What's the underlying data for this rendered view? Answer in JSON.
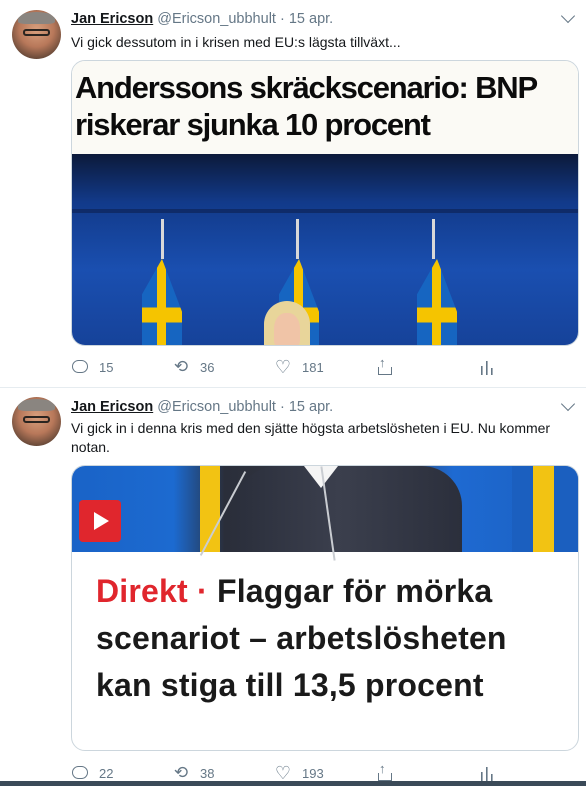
{
  "tweets": [
    {
      "author_name": "Jan Ericson",
      "handle": "@Ericson_ubbhult",
      "separator": "·",
      "date": "15 apr.",
      "text": "Vi gick dessutom in i krisen med EU:s lägsta tillväxt...",
      "card": {
        "headline_line1": "Anderssons skräckscenario: BNP",
        "headline_line2": "riskerar sjunka 10 procent"
      },
      "counts": {
        "replies": "15",
        "retweets": "36",
        "likes": "181"
      }
    },
    {
      "author_name": "Jan Ericson",
      "handle": "@Ericson_ubbhult",
      "separator": "·",
      "date": "15 apr.",
      "text": "Vi gick in i denna kris med den sjätte högsta arbetslösheten i EU. Nu kommer notan.",
      "card": {
        "kicker": "Direkt",
        "kicker_separator": " · ",
        "headline": "Flaggar för mörka scenariot – arbetslösheten kan stiga till 13,5 procent"
      },
      "counts": {
        "replies": "22",
        "retweets": "38",
        "likes": "193"
      }
    }
  ],
  "icons": {
    "reply": "reply-icon",
    "retweet": "retweet-icon",
    "like": "heart-icon",
    "share": "share-icon",
    "analytics": "analytics-icon",
    "more": "chevron-down-icon",
    "video": "play-icon"
  },
  "colors": {
    "text": "#14171a",
    "secondary": "#657786",
    "border": "#e6ecf0",
    "accent_red": "#e0262d",
    "flag_blue": "#1665c1",
    "flag_yellow": "#f5c400"
  }
}
